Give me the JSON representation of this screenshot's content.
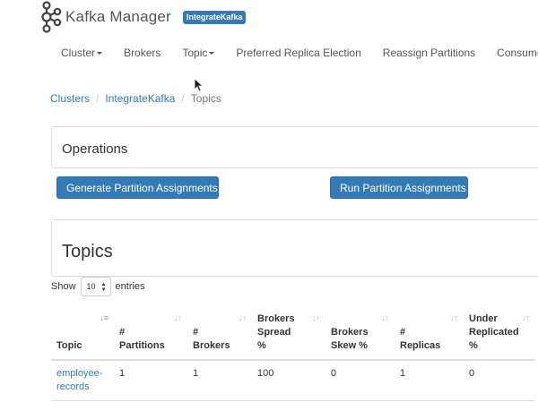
{
  "brand": {
    "name": "Kafka Manager",
    "cluster_badge": "IntegrateKafka"
  },
  "nav": [
    {
      "label": "Cluster",
      "dropdown": true
    },
    {
      "label": "Brokers",
      "dropdown": false
    },
    {
      "label": "Topic",
      "dropdown": true
    },
    {
      "label": "Preferred Replica Election",
      "dropdown": false
    },
    {
      "label": "Reassign Partitions",
      "dropdown": false
    },
    {
      "label": "Consumers",
      "dropdown": false
    }
  ],
  "breadcrumb": {
    "items": [
      "Clusters",
      "IntegrateKafka"
    ],
    "separator": "/",
    "active": "Topics"
  },
  "operations": {
    "title": "Operations",
    "generate_button": "Generate Partition Assignments",
    "run_button": "Run Partition Assignments"
  },
  "topics": {
    "title": "Topics",
    "show_label": "Show",
    "page_size": "10",
    "entries_label": "entries",
    "columns": [
      [
        "Topic"
      ],
      [
        "#",
        "Partitions"
      ],
      [
        "#",
        "Brokers"
      ],
      [
        "Brokers",
        "Spread",
        "%"
      ],
      [
        "Brokers",
        "Skew %"
      ],
      [
        "#",
        "Replicas"
      ],
      [
        "Under",
        "Replicated",
        "%"
      ]
    ],
    "rows": [
      {
        "topic": [
          "employee-",
          "records"
        ],
        "partitions": "1",
        "brokers": "1",
        "spread": "100",
        "skew": "0",
        "replicas": "1",
        "under_replicated": "0"
      }
    ]
  },
  "colors": {
    "link": "#337ab7",
    "button": "#337ab7",
    "badge": "#337ab7"
  }
}
